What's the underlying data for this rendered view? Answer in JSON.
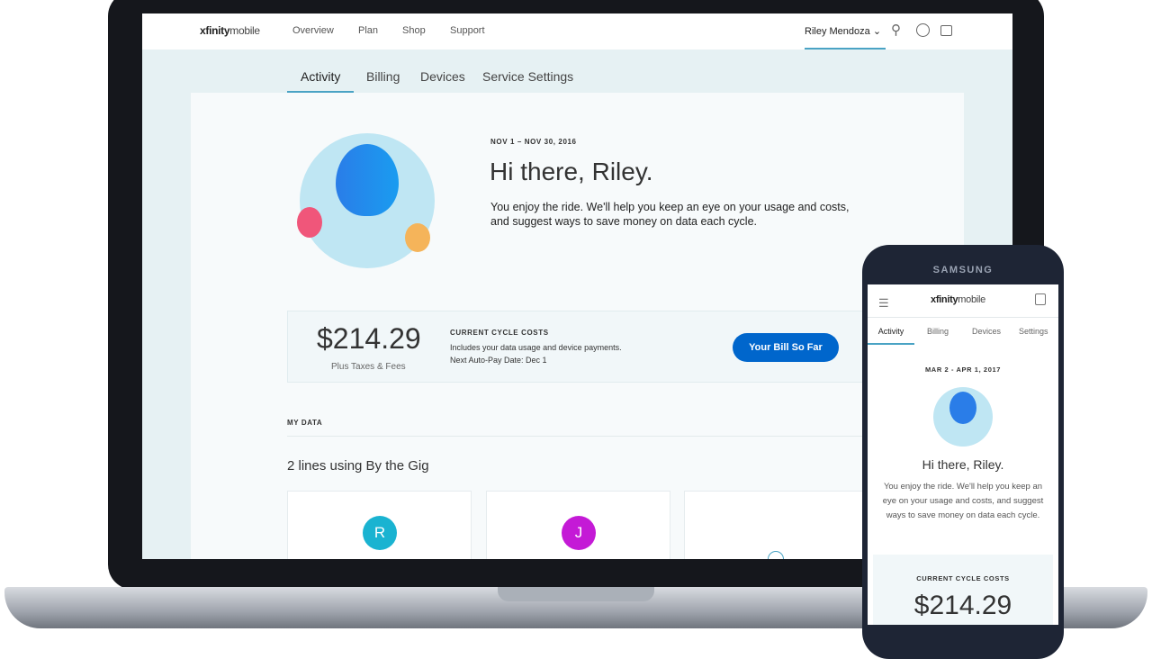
{
  "laptop": {
    "nav": {
      "logo_bold": "xfinity",
      "logo_light": "mobile",
      "links": [
        "Overview",
        "Plan",
        "Shop",
        "Support"
      ],
      "user": "Riley Mendoza"
    },
    "tabs": [
      "Activity",
      "Billing",
      "Devices",
      "Service Settings"
    ],
    "hero": {
      "date": "NOV 1 – NOV 30, 2016",
      "greeting": "Hi there, Riley.",
      "text1": "You enjoy the ride. We'll help you keep an eye on your usage and costs,",
      "text2": "and suggest ways to save money on data each cycle."
    },
    "cost": {
      "amount": "$214.29",
      "sub": "Plus Taxes & Fees",
      "title": "CURRENT CYCLE COSTS",
      "line1": "Includes your data usage and device payments.",
      "line2": "Next Auto-Pay Date: Dec 1",
      "button": "Your Bill So Far"
    },
    "mydata": {
      "label": "MY DATA",
      "heading": "2 lines using By the Gig",
      "lines": [
        {
          "initial": "R",
          "color": "#1ab3d1"
        },
        {
          "initial": "J",
          "color": "#c41ad6"
        }
      ]
    }
  },
  "phone": {
    "brand": "SAMSUNG",
    "logo_bold": "xfinity",
    "logo_light": "mobile",
    "tabs": [
      "Activity",
      "Billing",
      "Devices",
      "Settings"
    ],
    "date": "MAR 2 - APR 1, 2017",
    "greeting": "Hi there, Riley.",
    "text": "You enjoy the ride. We'll help you keep an eye on your usage and costs, and suggest ways to save money on data each cycle.",
    "cost_title": "CURRENT CYCLE COSTS",
    "amount": "$214.29"
  },
  "colors": {
    "accent": "#0066cc",
    "tab_underline": "#4aa3c4"
  }
}
